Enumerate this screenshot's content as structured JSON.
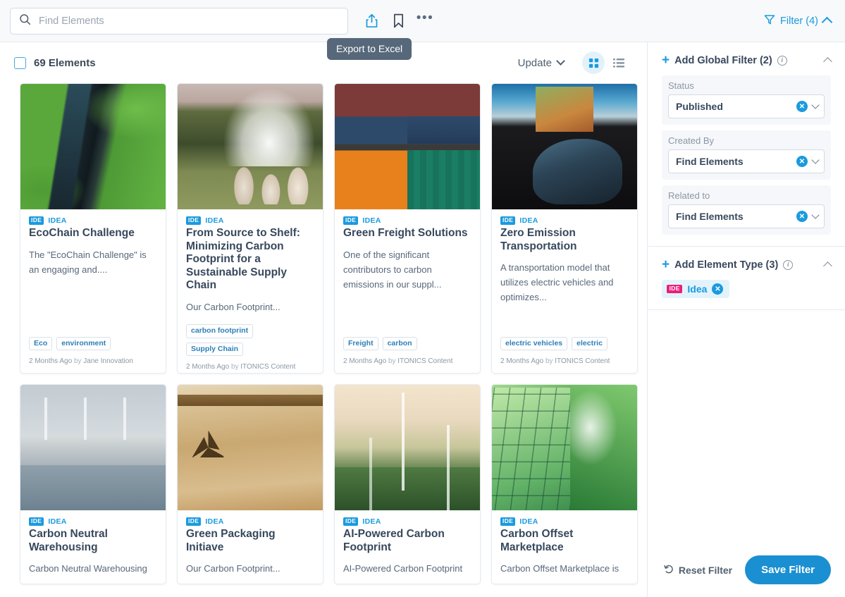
{
  "topbar": {
    "search_placeholder": "Find Elements",
    "search_value": "",
    "share_icon": "share-export-icon",
    "bookmark_icon": "bookmark-icon",
    "more_icon": "more-options-icon",
    "filter_label": "Filter (4)"
  },
  "tooltip": {
    "text": "Export to Excel"
  },
  "content_header": {
    "count_label": "69 Elements",
    "update_label": "Update",
    "grid_view_icon": "grid-view-icon",
    "list_view_icon": "list-view-icon",
    "active_view": "grid"
  },
  "cards": [
    {
      "type_badge": "IDE",
      "type_label": "IDEA",
      "title": "EcoChain Challenge",
      "description": "The \"EcoChain Challenge\" is an engaging and....",
      "tags": [
        "Eco",
        "environment"
      ],
      "time": "2 Months Ago",
      "by": "by",
      "author": "Jane Innovation",
      "image": "aerial-river-rainforest"
    },
    {
      "type_badge": "IDE",
      "type_label": "IDEA",
      "title": "From Source to Shelf: Minimizing Carbon Footprint for a Sustainable Supply Chain",
      "description": "Our Carbon Footprint...",
      "tags": [
        "carbon footprint",
        "Supply Chain"
      ],
      "time": "2 Months Ago",
      "by": "by",
      "author": "ITONICS Content",
      "image": "nuclear-cooling-towers"
    },
    {
      "type_badge": "IDE",
      "type_label": "IDEA",
      "title": "Green Freight Solutions",
      "description": "One of the significant contributors to carbon emissions in our suppl...",
      "tags": [
        "Freight",
        "carbon"
      ],
      "time": "2 Months Ago",
      "by": "by",
      "author": "ITONICS Content",
      "image": "shipping-containers"
    },
    {
      "type_badge": "IDE",
      "type_label": "IDEA",
      "title": "Zero Emission Transportation",
      "description": "A transportation model that utilizes electric vehicles and optimizes...",
      "tags": [
        "electric vehicles",
        "electric"
      ],
      "time": "2 Months Ago",
      "by": "by",
      "author": "ITONICS Content",
      "image": "electric-concept-car"
    },
    {
      "type_badge": "IDE",
      "type_label": "IDEA",
      "title": "Carbon Neutral Warehousing",
      "description": "Carbon Neutral Warehousing",
      "tags": [],
      "time": "",
      "by": "",
      "author": "",
      "image": "floating-warehouse-wind-turbines"
    },
    {
      "type_badge": "IDE",
      "type_label": "IDEA",
      "title": "Green Packaging Initiave",
      "description": "Our Carbon Footprint...",
      "tags": [],
      "time": "",
      "by": "",
      "author": "",
      "image": "recyclable-kraft-bag"
    },
    {
      "type_badge": "IDE",
      "type_label": "IDEA",
      "title": "AI-Powered Carbon Footprint",
      "description": "AI-Powered Carbon Footprint",
      "tags": [],
      "time": "",
      "by": "",
      "author": "",
      "image": "wind-turbines-green-icons"
    },
    {
      "type_badge": "IDE",
      "type_label": "IDEA",
      "title": "Carbon Offset Marketplace",
      "description": "Carbon Offset Marketplace is",
      "tags": [],
      "time": "",
      "by": "",
      "author": "",
      "image": "solar-panel-tree-canopy"
    }
  ],
  "panel": {
    "global_filter": {
      "add_label": "Add Global Filter (2)",
      "fields": [
        {
          "label": "Status",
          "value": "Published"
        },
        {
          "label": "Created By",
          "value": "Find Elements"
        },
        {
          "label": "Related to",
          "value": "Find Elements"
        }
      ]
    },
    "element_type": {
      "add_label": "Add Element Type (3)",
      "chips": [
        {
          "badge": "IDE",
          "label": "Idea"
        }
      ]
    },
    "footer": {
      "reset_label": "Reset Filter",
      "save_label": "Save Filter"
    }
  },
  "colors": {
    "accent_blue": "#1a9ade",
    "save_blue": "#1a8fd1",
    "chip_pink": "#ec1e79",
    "tooltip_bg": "#56687a",
    "text_dark": "#37485c",
    "text_muted": "#8b97a5"
  }
}
